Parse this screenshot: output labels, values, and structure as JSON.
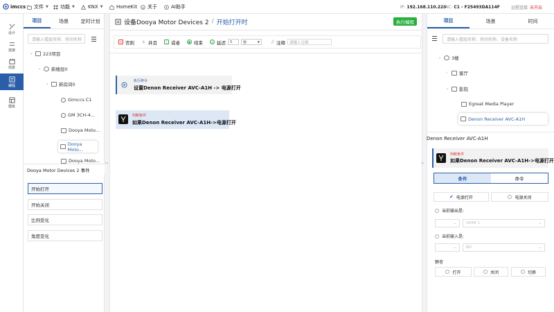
{
  "app": {
    "brand": "imccs"
  },
  "topmenu": {
    "file": "文件",
    "function": "功能",
    "knx": "KNX",
    "homekit": "HomeKit",
    "about": "关于",
    "ai": "AI助手"
  },
  "status": {
    "ip_label": "IP:",
    "ip": "192.168.110.223",
    "mac_label": "MAC:",
    "mac": "C1 - F25493DA114F",
    "remote_label": "远程连接",
    "remote_state": "未开启"
  },
  "leftnav": [
    {
      "label": "设计"
    },
    {
      "label": "连接"
    },
    {
      "label": "场景"
    },
    {
      "label": "编程"
    },
    {
      "label": "模板"
    }
  ],
  "project_panel": {
    "tabs": [
      "项目",
      "场景",
      "定时计划"
    ],
    "search_placeholder": "请输入楼层名称、房间名称",
    "tree": [
      {
        "label": "223项目"
      },
      {
        "label": "新楼层0"
      },
      {
        "label": "新房间0"
      },
      {
        "label": "Gimccs C1"
      },
      {
        "label": "GM 3CH-4..."
      },
      {
        "label": "Dooya Moto..."
      },
      {
        "label": "Dooya Moto..."
      },
      {
        "label": "Dooya Moto..."
      }
    ]
  },
  "events": {
    "title": "Dooya Motor Devices 2 事件",
    "items": [
      "开始打开",
      "开始关闭",
      "比例变化",
      "角度变化"
    ]
  },
  "editor": {
    "title": "设备Dooya Motor Devices 2",
    "separator": "/",
    "subtitle": "开始打开时",
    "run_button": "执行编程",
    "toolbar": {
      "no": "否则",
      "and": "并且",
      "or": "或者",
      "end": "结束",
      "delay": "延迟",
      "delay_value": "5",
      "delay_unit": "秒",
      "comment": "注释",
      "comment_placeholder": "请输入注释"
    },
    "blocks": [
      {
        "tag": "执行命令",
        "text": "设置Denon Receiver AVC-A1H -> 电源打开"
      },
      {
        "tag": "判断条件",
        "text": "如果Denon Receiver AVC-A1H->电源打开"
      }
    ]
  },
  "right_panel": {
    "tabs": [
      "项目",
      "场景",
      "时间"
    ],
    "search_placeholder": "请输入楼层名称、房间名称、设备名称",
    "tree": [
      {
        "label": "3楼"
      },
      {
        "label": "客厅"
      },
      {
        "label": "影院"
      },
      {
        "label": "Egreat Media Player"
      },
      {
        "label": "Denon Receiver AVC-A1H"
      }
    ],
    "device_title": "Denon Receiver AVC-A1H",
    "condition_card": {
      "tag": "判断条件",
      "text": "如果Denon Receiver AVC-A1H->电源打开"
    },
    "seg_tabs": [
      "条件",
      "命令"
    ],
    "power_on": "电源打开",
    "power_off": "电源关闭",
    "output_label": "当前输出是:",
    "output_value": "HDMI 1",
    "input_label": "当前输入是:",
    "input_value": "BD",
    "mute_label": "静音",
    "mute_options": [
      "打开",
      "关闭",
      "切换"
    ]
  },
  "colors": {
    "accent": "#2b5ea8",
    "run": "#27ae3c",
    "danger": "#d33333"
  }
}
